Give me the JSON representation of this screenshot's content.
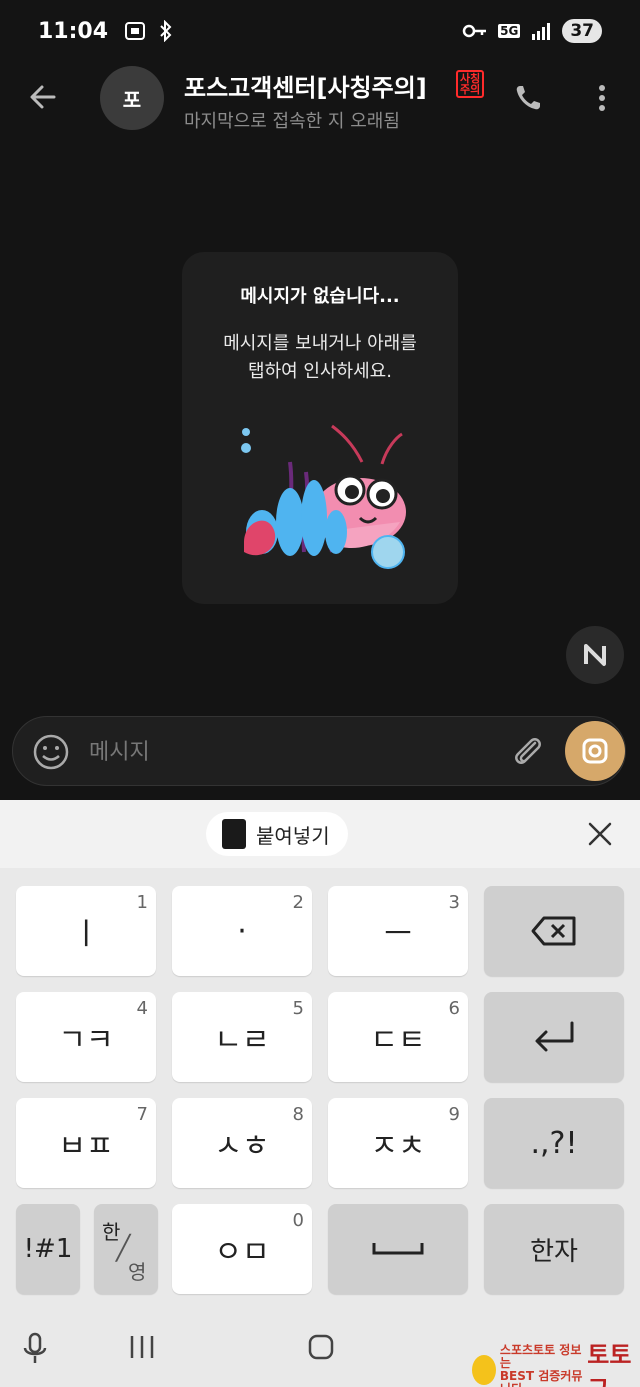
{
  "status_bar": {
    "time": "11:04",
    "network": "5G",
    "battery": "37"
  },
  "header": {
    "avatar_initial": "포",
    "title": "포스고객센터[사칭주의]",
    "warning_badge": "사칭\n주의",
    "subtitle": "마지막으로 접속한 지 오래됨"
  },
  "empty_state": {
    "title": "메시지가 없습니다...",
    "description": "메시지를 보내거나 아래를\n탭하여 인사하세요."
  },
  "composer": {
    "placeholder": "메시지"
  },
  "keyboard": {
    "paste_label": "붙여넣기",
    "keys": [
      {
        "label": "ㅣ",
        "num": "1"
      },
      {
        "label": "·",
        "num": "2"
      },
      {
        "label": "ㅡ",
        "num": "3"
      },
      {
        "label": "ㄱㅋ",
        "num": "4"
      },
      {
        "label": "ㄴㄹ",
        "num": "5"
      },
      {
        "label": "ㄷㅌ",
        "num": "6"
      },
      {
        "label": "ㅂㅍ",
        "num": "7"
      },
      {
        "label": "ㅅㅎ",
        "num": "8"
      },
      {
        "label": "ㅈㅊ",
        "num": "9"
      },
      {
        "label": ".,?!",
        "num": ""
      },
      {
        "label": "!#1",
        "num": ""
      },
      {
        "label_top": "한",
        "label_bottom": "영"
      },
      {
        "label": "ㅇㅁ",
        "num": "0"
      },
      {
        "label": "한자",
        "num": ""
      }
    ]
  },
  "watermark": {
    "line1": "스포츠토토 정보는",
    "line2": "BEST 검증커뮤니티",
    "brand": "토토군"
  },
  "colors": {
    "background": "#141414",
    "camera_button": "#d6a86a",
    "keyboard": "#e9e9e9"
  }
}
